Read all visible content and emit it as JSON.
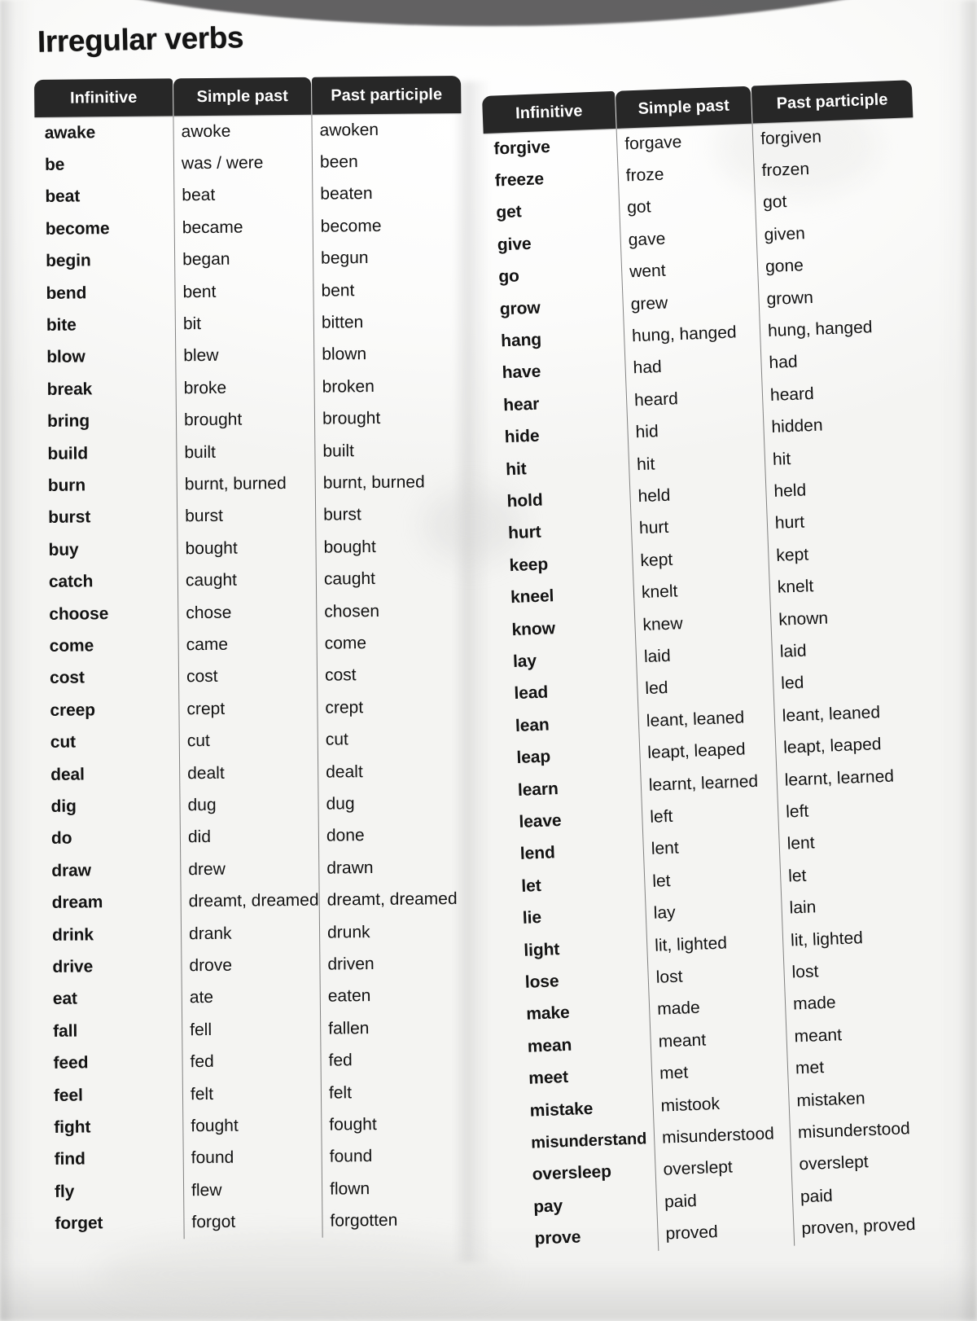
{
  "page": {
    "title": "Irregular verbs"
  },
  "columns": [
    "Infinitive",
    "Simple past",
    "Past participle"
  ],
  "tables": [
    {
      "id": "left",
      "headers": [
        "Infinitive",
        "Simple past",
        "Past participle"
      ],
      "rows": [
        [
          "awake",
          "awoke",
          "awoken"
        ],
        [
          "be",
          "was / were",
          "been"
        ],
        [
          "beat",
          "beat",
          "beaten"
        ],
        [
          "become",
          "became",
          "become"
        ],
        [
          "begin",
          "began",
          "begun"
        ],
        [
          "bend",
          "bent",
          "bent"
        ],
        [
          "bite",
          "bit",
          "bitten"
        ],
        [
          "blow",
          "blew",
          "blown"
        ],
        [
          "break",
          "broke",
          "broken"
        ],
        [
          "bring",
          "brought",
          "brought"
        ],
        [
          "build",
          "built",
          "built"
        ],
        [
          "burn",
          "burnt, burned",
          "burnt, burned"
        ],
        [
          "burst",
          "burst",
          "burst"
        ],
        [
          "buy",
          "bought",
          "bought"
        ],
        [
          "catch",
          "caught",
          "caught"
        ],
        [
          "choose",
          "chose",
          "chosen"
        ],
        [
          "come",
          "came",
          "come"
        ],
        [
          "cost",
          "cost",
          "cost"
        ],
        [
          "creep",
          "crept",
          "crept"
        ],
        [
          "cut",
          "cut",
          "cut"
        ],
        [
          "deal",
          "dealt",
          "dealt"
        ],
        [
          "dig",
          "dug",
          "dug"
        ],
        [
          "do",
          "did",
          "done"
        ],
        [
          "draw",
          "drew",
          "drawn"
        ],
        [
          "dream",
          "dreamt, dreamed",
          "dreamt, dreamed"
        ],
        [
          "drink",
          "drank",
          "drunk"
        ],
        [
          "drive",
          "drove",
          "driven"
        ],
        [
          "eat",
          "ate",
          "eaten"
        ],
        [
          "fall",
          "fell",
          "fallen"
        ],
        [
          "feed",
          "fed",
          "fed"
        ],
        [
          "feel",
          "felt",
          "felt"
        ],
        [
          "fight",
          "fought",
          "fought"
        ],
        [
          "find",
          "found",
          "found"
        ],
        [
          "fly",
          "flew",
          "flown"
        ],
        [
          "forget",
          "forgot",
          "forgotten"
        ]
      ]
    },
    {
      "id": "right",
      "headers": [
        "Infinitive",
        "Simple past",
        "Past participle"
      ],
      "rows": [
        [
          "forgive",
          "forgave",
          "forgiven"
        ],
        [
          "freeze",
          "froze",
          "frozen"
        ],
        [
          "get",
          "got",
          "got"
        ],
        [
          "give",
          "gave",
          "given"
        ],
        [
          "go",
          "went",
          "gone"
        ],
        [
          "grow",
          "grew",
          "grown"
        ],
        [
          "hang",
          "hung, hanged",
          "hung, hanged"
        ],
        [
          "have",
          "had",
          "had"
        ],
        [
          "hear",
          "heard",
          "heard"
        ],
        [
          "hide",
          "hid",
          "hidden"
        ],
        [
          "hit",
          "hit",
          "hit"
        ],
        [
          "hold",
          "held",
          "held"
        ],
        [
          "hurt",
          "hurt",
          "hurt"
        ],
        [
          "keep",
          "kept",
          "kept"
        ],
        [
          "kneel",
          "knelt",
          "knelt"
        ],
        [
          "know",
          "knew",
          "known"
        ],
        [
          "lay",
          "laid",
          "laid"
        ],
        [
          "lead",
          "led",
          "led"
        ],
        [
          "lean",
          "leant, leaned",
          "leant, leaned"
        ],
        [
          "leap",
          "leapt, leaped",
          "leapt, leaped"
        ],
        [
          "learn",
          "learnt, learned",
          "learnt, learned"
        ],
        [
          "leave",
          "left",
          "left"
        ],
        [
          "lend",
          "lent",
          "lent"
        ],
        [
          "let",
          "let",
          "let"
        ],
        [
          "lie",
          "lay",
          "lain"
        ],
        [
          "light",
          "lit, lighted",
          "lit, lighted"
        ],
        [
          "lose",
          "lost",
          "lost"
        ],
        [
          "make",
          "made",
          "made"
        ],
        [
          "mean",
          "meant",
          "meant"
        ],
        [
          "meet",
          "met",
          "met"
        ],
        [
          "mistake",
          "mistook",
          "mistaken"
        ],
        [
          "misunderstand",
          "misunderstood",
          "misunderstood"
        ],
        [
          "oversleep",
          "overslept",
          "overslept"
        ],
        [
          "pay",
          "paid",
          "paid"
        ],
        [
          "prove",
          "proved",
          "proven, proved"
        ]
      ]
    }
  ],
  "colors": {
    "header_background": "#272727",
    "header_text": "#ffffff",
    "body_text": "#131313",
    "page_background": "#fdfdfc",
    "rule": "#3a3a3a"
  }
}
